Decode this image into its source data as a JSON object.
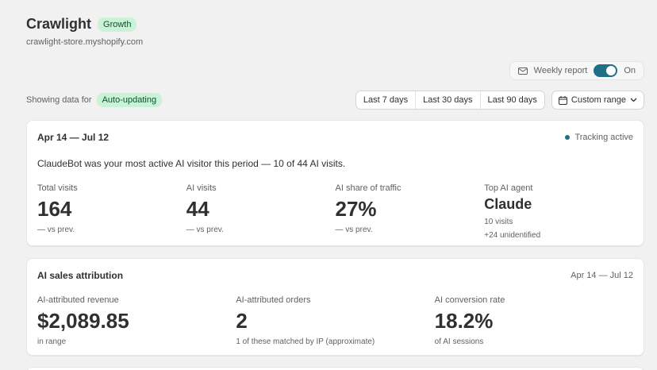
{
  "store": {
    "name": "Crawlight",
    "plan": "Growth",
    "domain": "crawlight-store.myshopify.com"
  },
  "weekly_report": {
    "label": "Weekly report",
    "state": "On",
    "enabled": true
  },
  "filter": {
    "showing_label": "Showing data for",
    "mode_badge": "Auto-updating",
    "ranges": [
      "Last 7 days",
      "Last 30 days",
      "Last 90 days"
    ],
    "custom_label": "Custom range"
  },
  "overview": {
    "date_range": "Apr 14 — Jul 12",
    "tracking_status": "Tracking active",
    "headline": "ClaudeBot was your most active AI visitor this period — 10 of 44 AI visits.",
    "metrics": [
      {
        "label": "Total visits",
        "value": "164",
        "sub": "— vs prev."
      },
      {
        "label": "AI visits",
        "value": "44",
        "sub": "— vs prev."
      },
      {
        "label": "AI share of traffic",
        "value": "27%",
        "sub": "— vs prev."
      },
      {
        "label": "Top AI agent",
        "value": "Claude",
        "sub": "10 visits",
        "sub2": "+24 unidentified"
      }
    ]
  },
  "attribution": {
    "title": "AI sales attribution",
    "date_range": "Apr 14 — Jul 12",
    "metrics": [
      {
        "label": "AI-attributed revenue",
        "value": "$2,089.85",
        "sub": "in range"
      },
      {
        "label": "AI-attributed orders",
        "value": "2",
        "sub": "1 of these matched by IP (approximate)"
      },
      {
        "label": "AI conversion rate",
        "value": "18.2%",
        "sub": "of AI sessions"
      }
    ]
  },
  "colors": {
    "accent": "#1f6f86",
    "badge_bg": "#c9f2d6",
    "badge_text": "#0c5132",
    "page_bg": "#f1f1f1"
  }
}
